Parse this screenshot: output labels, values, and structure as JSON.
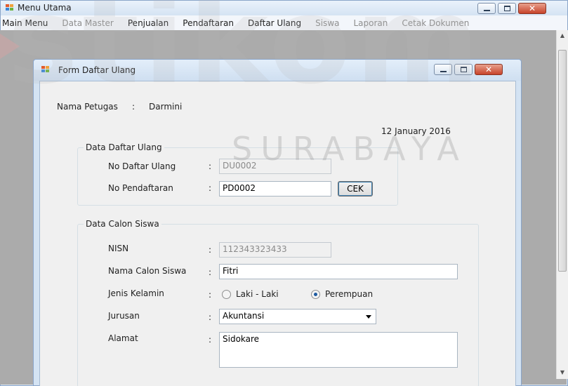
{
  "main_window": {
    "title": "Menu Utama",
    "menu": [
      {
        "label": "Main Menu",
        "enabled": true
      },
      {
        "label": "Data Master",
        "enabled": false
      },
      {
        "label": "Penjualan",
        "enabled": true
      },
      {
        "label": "Pendaftaran",
        "enabled": true
      },
      {
        "label": "Daftar Ulang",
        "enabled": true
      },
      {
        "label": "Siswa",
        "enabled": false
      },
      {
        "label": "Laporan",
        "enabled": false
      },
      {
        "label": "Cetak Dokumen",
        "enabled": false
      }
    ]
  },
  "form": {
    "title": "Form Daftar Ulang",
    "petugas_label": "Nama Petugas",
    "petugas_sep": ":",
    "petugas_value": "Darmini",
    "date": "12 January 2016",
    "group_daftar_ulang": {
      "title": "Data Daftar Ulang",
      "no_daftar_ulang_label": "No Daftar Ulang",
      "no_daftar_ulang_value": "DU0002",
      "no_pendaftaran_label": "No Pendaftaran",
      "no_pendaftaran_value": "PD0002",
      "cek_label": "CEK",
      "sep": ":"
    },
    "group_calon_siswa": {
      "title": "Data Calon Siswa",
      "nisn_label": "NISN",
      "nisn_value": "112343323433",
      "nama_label": "Nama Calon Siswa",
      "nama_value": "Fitri",
      "jk_label": "Jenis Kelamin",
      "jk_option_laki": "Laki - Laki",
      "jk_option_perempuan": "Perempuan",
      "jk_selected": "Perempuan",
      "jurusan_label": "Jurusan",
      "jurusan_value": "Akuntansi",
      "alamat_label": "Alamat",
      "alamat_value": "Sidokare",
      "sep": ":"
    }
  },
  "watermark": {
    "text_big": "stikom",
    "text_small": "SURABAYA"
  },
  "colors": {
    "title_bar": "#d5e3f3",
    "close_button": "#c7432a",
    "mdi_background": "#ababab",
    "form_background": "#f0f0f0",
    "watermark_accent": "#e8a0a0"
  }
}
